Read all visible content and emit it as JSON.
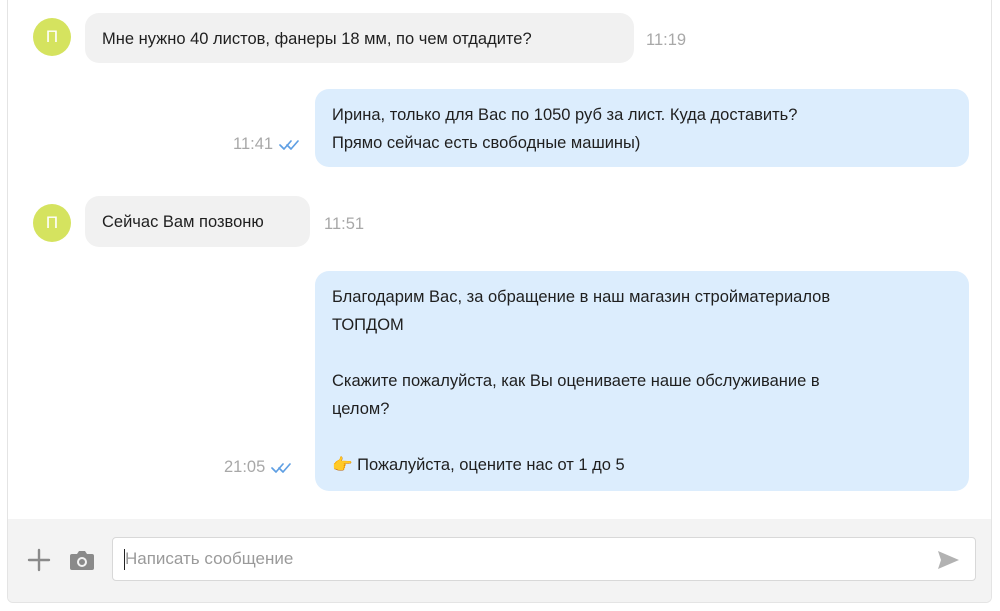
{
  "conversation": {
    "messages": [
      {
        "direction": "incoming",
        "avatar_letter": "П",
        "lines": [
          "Мне нужно 40 листов, фанеры 18 мм, по чем отдадите?"
        ],
        "time": "11:19"
      },
      {
        "direction": "outgoing",
        "lines": [
          "Ирина, только для Вас по 1050 руб за лист. Куда доставить?",
          "Прямо сейчас есть свободные машины)"
        ],
        "time": "11:41",
        "status_icon": "double-check-icon"
      },
      {
        "direction": "incoming",
        "avatar_letter": "П",
        "lines": [
          "Сейчас Вам позвоню"
        ],
        "time": "11:51"
      },
      {
        "direction": "outgoing",
        "lines": [
          "Благодарим Вас, за обращение в наш магазин стройматериалов",
          "ТОПДОМ",
          "",
          "Скажите пожалуйста, как Вы оцениваете наше обслуживание в",
          "целом?",
          "",
          "👉 Пожалуйста, оцените нас от 1 до 5"
        ],
        "time": "21:05",
        "status_icon": "double-check-icon"
      }
    ]
  },
  "composer": {
    "placeholder": "Написать сообщение",
    "value": "",
    "icons": {
      "attach": "plus-icon",
      "photo": "camera-icon",
      "send": "send-icon"
    }
  },
  "colors": {
    "avatar": "#d5e35f",
    "incoming_bubble": "#f1f1f1",
    "outgoing_bubble": "#dcedfd",
    "read_check": "#5f9fe3",
    "timestamp": "#a8a8a8",
    "composer_background": "#f3f3f3"
  }
}
